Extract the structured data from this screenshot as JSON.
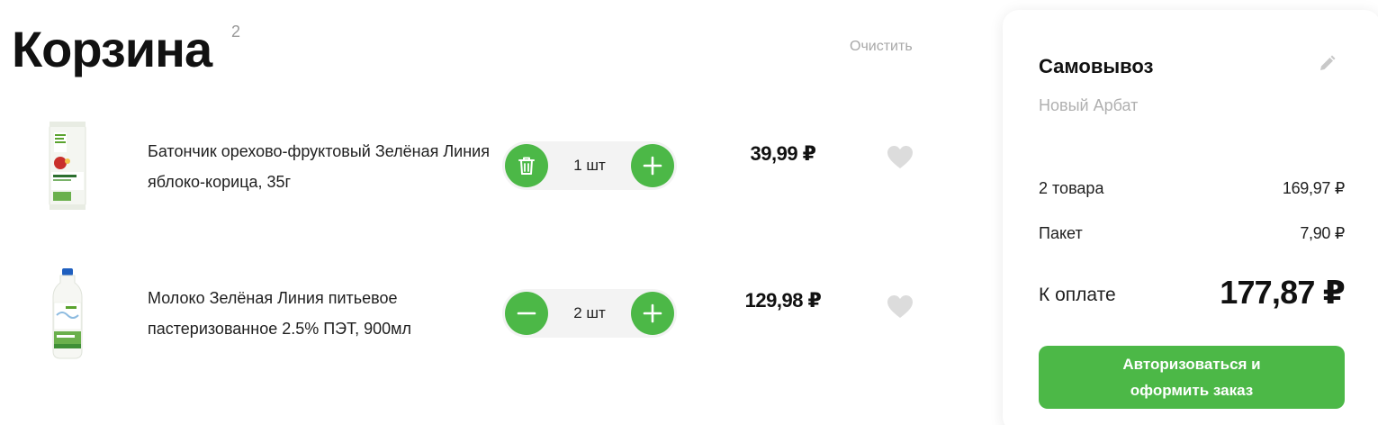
{
  "header": {
    "title": "Корзина",
    "count": "2",
    "clear_label": "Очистить"
  },
  "items": [
    {
      "name": "Батончик орехово-фруктовый Зелёная Линия яблоко-корица, 35г",
      "quantity": "1 шт",
      "price": "39,99 ₽",
      "left_action_icon": "trash-icon",
      "right_action_icon": "plus-icon",
      "favorite_icon": "heart-icon",
      "product_image": "snack-bar-image",
      "accent": "#4cb847"
    },
    {
      "name": "Молоко Зелёная Линия питьевое пастеризованное 2.5% ПЭТ, 900мл",
      "quantity": "2 шт",
      "price": "129,98 ₽",
      "left_action_icon": "minus-icon",
      "right_action_icon": "plus-icon",
      "favorite_icon": "heart-icon",
      "product_image": "milk-bottle-image",
      "accent": "#4cb847"
    }
  ],
  "summary": {
    "delivery_title": "Самовывоз",
    "delivery_address": "Новый Арбат",
    "edit_icon": "pencil-icon",
    "goods_label": "2 товара",
    "goods_value": "169,97 ₽",
    "bag_label": "Пакет",
    "bag_value": "7,90 ₽",
    "total_label": "К оплате",
    "total_value": "177,87 ₽",
    "checkout_label": "Авторизоваться и оформить заказ"
  },
  "colors": {
    "accent": "#4cb847",
    "muted": "#a8a8a8",
    "favorite_icon": "#d9d9d9"
  }
}
